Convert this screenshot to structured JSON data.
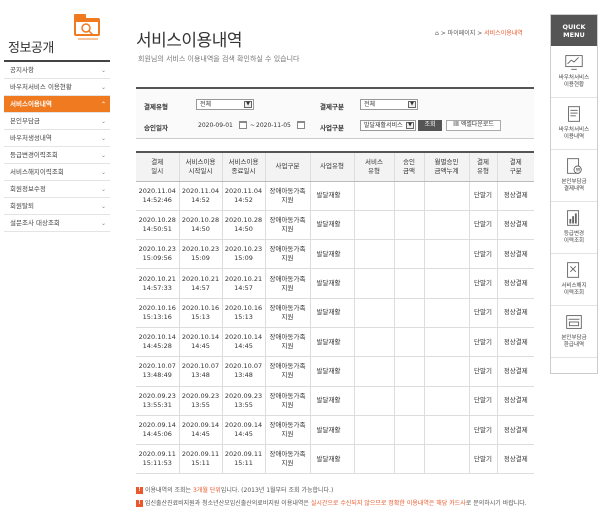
{
  "sidebar": {
    "title": "정보공개",
    "items": [
      {
        "label": "공지사항"
      },
      {
        "label": "바우처서비스 이용현황"
      },
      {
        "label": "서비스이용내역",
        "active": true
      },
      {
        "label": "본인부담금"
      },
      {
        "label": "바우처생성내역"
      },
      {
        "label": "등급변경이력조회"
      },
      {
        "label": "서비스해지이력조회"
      },
      {
        "label": "회원정보수정"
      },
      {
        "label": "회원탈퇴"
      },
      {
        "label": "설문조사 대상조회"
      }
    ]
  },
  "header": {
    "title": "서비스이용내역",
    "description": "회원님의 서비스 이용내역을 검색 확인하실 수 있습니다",
    "breadcrumb": {
      "level1": "마이페이지",
      "level2": "서비스이용내역"
    }
  },
  "search": {
    "payment_type_label": "결제유형",
    "payment_type_value": "전체",
    "payment_status_label": "결제구분",
    "payment_status_value": "전체",
    "approval_date_label": "승인일자",
    "date_from": "2020-09-01",
    "date_separator": "~",
    "date_to": "2020-11-05",
    "business_type_label": "사업구분",
    "business_type_value": "발달재활서비스",
    "search_button": "조회",
    "excel_button": "엑셀다운로드"
  },
  "table": {
    "headers": [
      "결제\n일시",
      "서비스이용\n시작일시",
      "서비스이용\n종료일시",
      "사업구분",
      "사업유형",
      "서비스\n유형",
      "승인\n금액",
      "월별승인\n금액누계",
      "결제\n유형",
      "결제\n구분"
    ],
    "rows": [
      {
        "pay_dt": "2020.11.04\n14:52:46",
        "start": "2020.11.04\n14:52",
        "end": "2020.11.04\n14:52",
        "biz": "장애아동가족\n지원",
        "type": "발달재활",
        "service": "",
        "amount": "",
        "monthly": "",
        "pay_type": "단말기",
        "pay_status": "정상결제"
      },
      {
        "pay_dt": "2020.10.28\n14:50:51",
        "start": "2020.10.28\n14:50",
        "end": "2020.10.28\n14:50",
        "biz": "장애아동가족\n지원",
        "type": "발달재활",
        "service": "",
        "amount": "",
        "monthly": "",
        "pay_type": "단말기",
        "pay_status": "정상결제"
      },
      {
        "pay_dt": "2020.10.23\n15:09:56",
        "start": "2020.10.23\n15:09",
        "end": "2020.10.23\n15:09",
        "biz": "장애아동가족\n지원",
        "type": "발달재활",
        "service": "",
        "amount": "",
        "monthly": "",
        "pay_type": "단말기",
        "pay_status": "정상결제"
      },
      {
        "pay_dt": "2020.10.21\n14:57:33",
        "start": "2020.10.21\n14:57",
        "end": "2020.10.21\n14:57",
        "biz": "장애아동가족\n지원",
        "type": "발달재활",
        "service": "",
        "amount": "",
        "monthly": "",
        "pay_type": "단말기",
        "pay_status": "정상결제"
      },
      {
        "pay_dt": "2020.10.16\n15:13:16",
        "start": "2020.10.16\n15:13",
        "end": "2020.10.16\n15:13",
        "biz": "장애아동가족\n지원",
        "type": "발달재활",
        "service": "",
        "amount": "",
        "monthly": "",
        "pay_type": "단말기",
        "pay_status": "정상결제"
      },
      {
        "pay_dt": "2020.10.14\n14:45:28",
        "start": "2020.10.14\n14:45",
        "end": "2020.10.14\n14:45",
        "biz": "장애아동가족\n지원",
        "type": "발달재활",
        "service": "",
        "amount": "",
        "monthly": "",
        "pay_type": "단말기",
        "pay_status": "정상결제"
      },
      {
        "pay_dt": "2020.10.07\n13:48:49",
        "start": "2020.10.07\n13:48",
        "end": "2020.10.07\n13:48",
        "biz": "장애아동가족\n지원",
        "type": "발달재활",
        "service": "",
        "amount": "",
        "monthly": "",
        "pay_type": "단말기",
        "pay_status": "정상결제"
      },
      {
        "pay_dt": "2020.09.23\n13:55:31",
        "start": "2020.09.23\n13:55",
        "end": "2020.09.23\n13:55",
        "biz": "장애아동가족\n지원",
        "type": "발달재활",
        "service": "",
        "amount": "",
        "monthly": "",
        "pay_type": "단말기",
        "pay_status": "정상결제"
      },
      {
        "pay_dt": "2020.09.14\n14:45:06",
        "start": "2020.09.14\n14:45",
        "end": "2020.09.14\n14:45",
        "biz": "장애아동가족\n지원",
        "type": "발달재활",
        "service": "",
        "amount": "",
        "monthly": "",
        "pay_type": "단말기",
        "pay_status": "정상결제"
      },
      {
        "pay_dt": "2020.09.11\n15:11:53",
        "start": "2020.09.11\n15:11",
        "end": "2020.09.11\n15:11",
        "biz": "장애아동가족\n지원",
        "type": "발달재활",
        "service": "",
        "amount": "",
        "monthly": "",
        "pay_type": "단말기",
        "pay_status": "정상결제"
      }
    ]
  },
  "notes": {
    "note1_a": "이용내역의 조회는 ",
    "note1_hl": "3개월 단위",
    "note1_b": "입니다. (2013년 1월부터 조회 가능합니다.)",
    "note2_a": "임신출산진료비지원과 청소년산모임신출산의료비지원 이용내역은 ",
    "note2_hl": "실시간으로 수신되지 않으므로 정확한 이용내역은 해당 카드사",
    "note2_b": "로 문의하시기 바랍니다."
  },
  "quick_menu": {
    "title_line1": "QUICK",
    "title_line2": "MENU",
    "items": [
      {
        "label": "바우처서비스\n이용현황",
        "icon": "chart-monitor-icon"
      },
      {
        "label": "바우처서비스\n이용내역",
        "icon": "receipt-icon"
      },
      {
        "label": "본인부담금\n결제내역",
        "icon": "payment-doc-icon"
      },
      {
        "label": "등급변경\n이력조회",
        "icon": "grade-doc-icon"
      },
      {
        "label": "서비스해지\n이력조회",
        "icon": "cancel-doc-icon"
      },
      {
        "label": "본인부담금\n환급내역",
        "icon": "refund-doc-icon"
      }
    ]
  },
  "colors": {
    "accent": "#f07a20",
    "highlight": "#e9592c",
    "dark": "#555555"
  }
}
